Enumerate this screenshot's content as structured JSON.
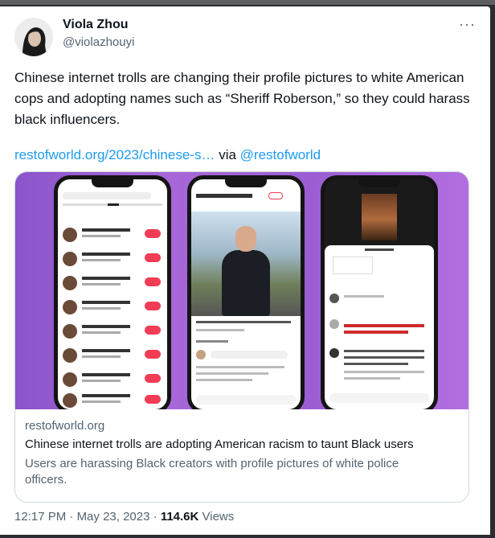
{
  "author": {
    "name": "Viola Zhou",
    "handle": "@violazhouyi"
  },
  "tweet": {
    "text": "Chinese internet trolls are changing their profile pictures to white American cops and adopting names such as “Sheriff Roberson,” so they could harass black influencers.",
    "link_text": "restofworld.org/2023/chinese-s…",
    "via_text": "via",
    "via_handle": "@restofworld"
  },
  "more_icon": "ellipsis-icon",
  "card": {
    "domain": "restofworld.org",
    "title": "Chinese internet trolls are adopting American racism to taunt Black users",
    "description": "Users are harassing Black creators with profile pictures of white police officers."
  },
  "meta": {
    "time": "12:17 PM",
    "separator1": " · ",
    "date": "May 23, 2023",
    "separator2": " · ",
    "views_count": "114.6K",
    "views_label": " Views"
  },
  "colors": {
    "link": "#1d9bf0",
    "secondary_text": "#536471",
    "media_bg": "#9b5dd2"
  }
}
